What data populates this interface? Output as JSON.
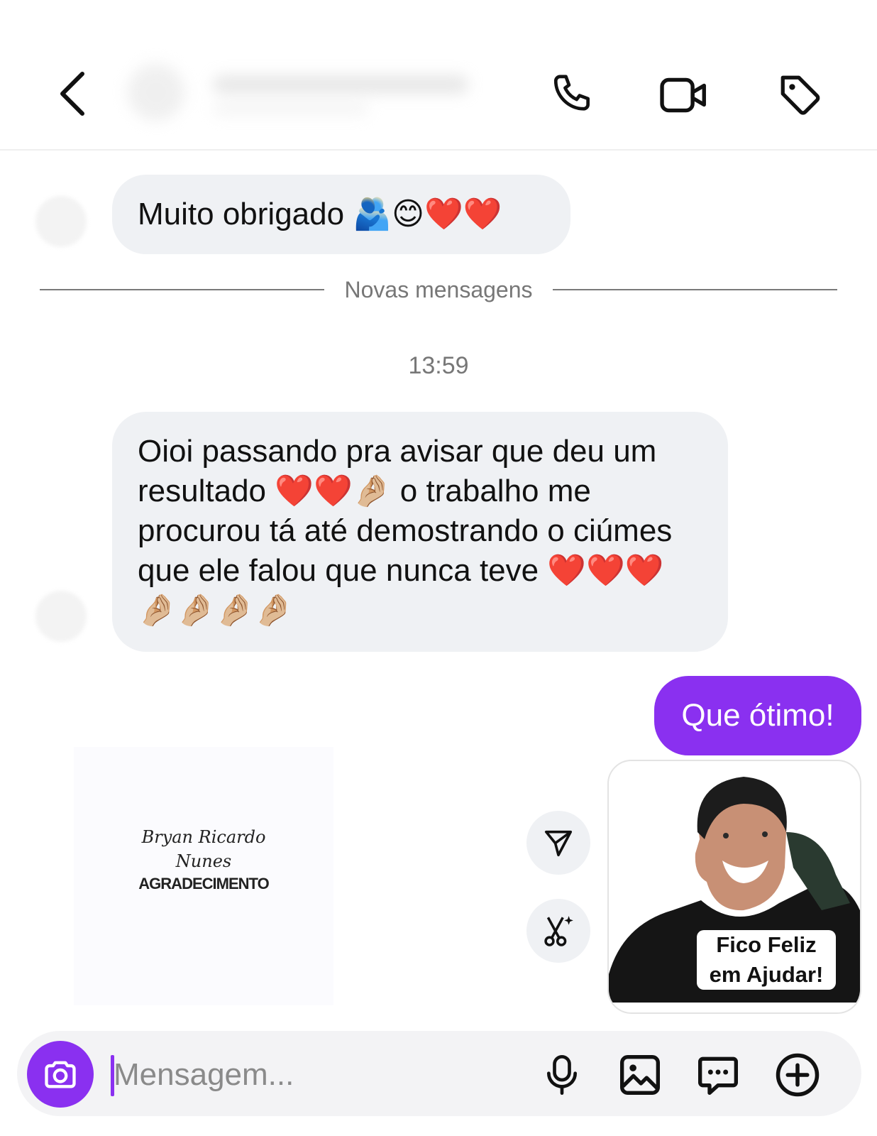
{
  "header": {
    "back_icon": "chevron-left-icon",
    "actions": [
      {
        "name": "phone-call",
        "icon": "phone-icon"
      },
      {
        "name": "video-call",
        "icon": "video-camera-icon"
      },
      {
        "name": "tag",
        "icon": "tag-icon"
      }
    ]
  },
  "messages": {
    "incoming_1": "Muito obrigado 🫂😊❤️❤️",
    "divider": "Novas mensagens",
    "timestamp": "13:59",
    "incoming_2": "Oioi passando pra avisar que deu um resultado ❤️❤️🤌🏼 o trabalho me procurou tá até demostrando o ciúmes que ele falou que nunca teve ❤️❤️❤️🤌🏼🤌🏼🤌🏼🤌🏼",
    "outgoing_1": "Que ótimo!",
    "sticker_left": {
      "script_line1": "Bryan Ricardo",
      "script_line2": "Nunes",
      "caps": "AGRADECIMENTO"
    },
    "photo_sticker_caption_line1": "Fico Feliz",
    "photo_sticker_caption_line2": "em Ajudar!"
  },
  "composer": {
    "placeholder": "Mensagem...",
    "icons": [
      "camera-icon",
      "microphone-icon",
      "image-icon",
      "sticker-icon",
      "plus-icon"
    ]
  },
  "colors": {
    "accent": "#8a30f0",
    "bubble_incoming": "#eff1f4",
    "muted_text": "#777777"
  }
}
